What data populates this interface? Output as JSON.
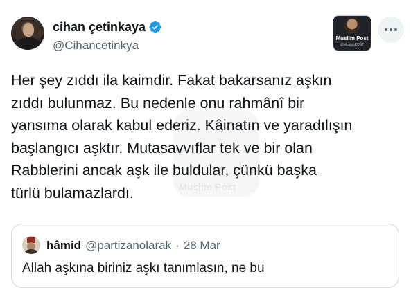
{
  "author": {
    "display_name": "cihan çetinkaya",
    "handle": "@Cihancetinkya",
    "verified_icon": "verified-badge-icon",
    "verified_color": "#1d9bf0",
    "affiliate": {
      "name": "Muslim Post",
      "handle": "@MuslimPOST"
    }
  },
  "more_icon": "more-horizontal-icon",
  "tweet": {
    "lines": [
      "Her şey zıddı ila kaimdir. Fakat bakarsanız aşkın",
      "zıddı bulunmaz. Bu nedenle onu rahmânî bir",
      "yansıma olarak kabul ederiz. Kâinatın ve yaradılışın",
      "başlangıcı aşktır. Mutasavvıflar tek ve bir olan",
      "Rabblerini ancak aşk ile buldular, çünkü başka",
      "türlü bulamazlardı."
    ]
  },
  "watermark": {
    "text": "Muslim Post"
  },
  "quoted_tweet": {
    "display_name": "hâmid",
    "handle": "@partizanolarak",
    "separator": "·",
    "date": "28 Mar",
    "text": "Allah aşkına biriniz aşkı tanımlasın, ne bu"
  },
  "colors": {
    "text_primary": "#0f1419",
    "text_secondary": "#536471",
    "border": "#cfd9de",
    "accent": "#1d9bf0"
  }
}
